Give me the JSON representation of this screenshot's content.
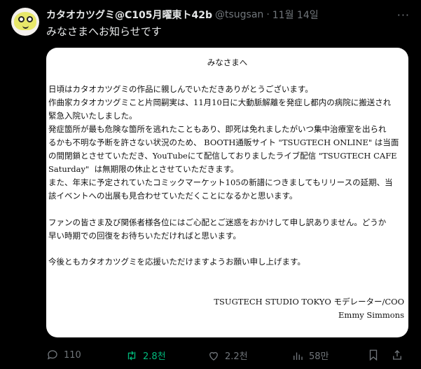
{
  "tweet": {
    "author_name": "カタオカツグミ@C105月曜東ト42b",
    "handle": "@tsugsan",
    "separator": "·",
    "time": "11월 14일",
    "more_label": "···",
    "text": "みなさまへお知らせです"
  },
  "notice": {
    "title": "みなさまへ",
    "para1": "日頃はカタオカツグミの作品に親しんでいただきありがとうございます。\n作曲家カタオカツグミこと片岡嗣実は、11月10日に大動脈解離を発症し都内の病院に搬送され\n緊急入院いたしました。\n発症箇所が最も危険な箇所を逃れたこともあり、即死は免れましたがいつ集中治療室を出られ\nるかも不明な予断を許さない状況のため、 BOOTH通販サイト \"TSUGTECH ONLINE\" は当面\nの間閉鎖とさせていただき、YouTubeにて配信しておりましたライブ配信 \"TSUGTECH CAFE\nSaturday\"  は無期限の休止とさせていただきます。\nまた、年末に予定されていたコミックマーケット105の新譜につきましてもリリースの延期、当\n該イベントへの出展も見合わせていただくことになるかと思います。",
    "para2": "ファンの皆さま及び関係者様各位にはご心配とご迷惑をおかけして申し訳ありません。どうか\n早い時期での回復をお待ちいただければと思います。",
    "para3": "今後ともカタオカツグミを応援いただけますようお願い申し上げます。",
    "signature_line1": "TSUGTECH STUDIO TOKYO  モデレーター/COO",
    "signature_line2": "Emmy Simmons"
  },
  "actions": {
    "replies": "110",
    "retweets": "2.8천",
    "likes": "2.2천",
    "views": "58만"
  },
  "colors": {
    "background": "#000000",
    "text": "#e7e9ea",
    "muted": "#71767b",
    "retweet_active": "#00ba7c"
  }
}
